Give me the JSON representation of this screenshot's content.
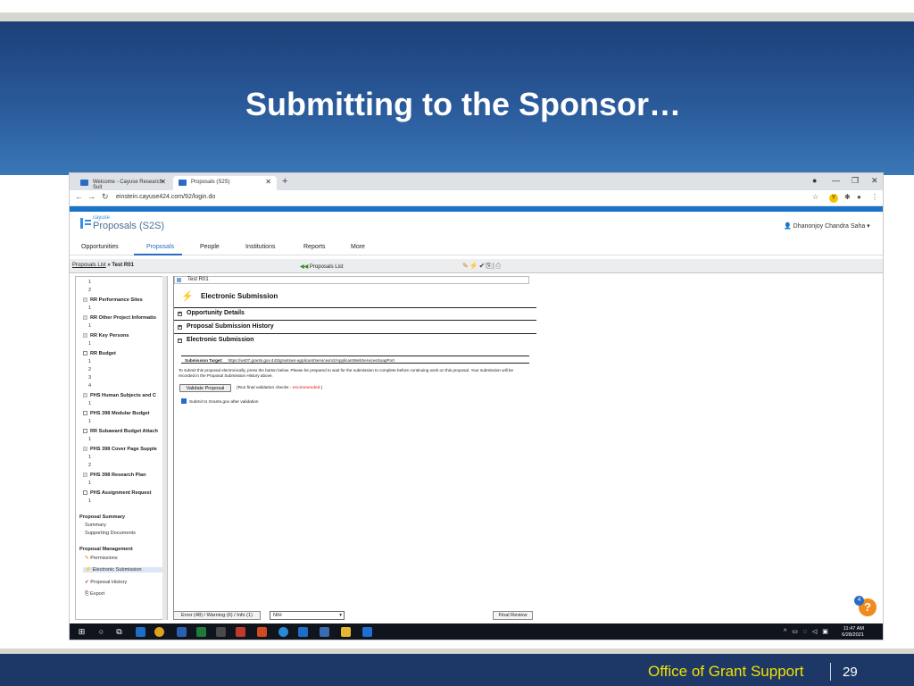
{
  "slide": {
    "title": "Submitting to the Sponsor…",
    "footer_office": "Office of Grant Support",
    "page_number": "29"
  },
  "browser": {
    "tabs": [
      {
        "label": "Welcome - Cayuse Research Suit"
      },
      {
        "label": "Proposals (S2S)"
      }
    ],
    "url": "einstein.cayuse424.com/92/login.do"
  },
  "app": {
    "brand_small": "cayuse",
    "brand_big": "Proposals (S2S)",
    "user": "Dhanonjoy Chandra Saha",
    "menu": [
      "Opportunities",
      "Proposals",
      "People",
      "Institutions",
      "Reports",
      "More"
    ],
    "breadcrumb_link": "Proposals List",
    "breadcrumb_current": "» Test R01",
    "proposals_list": "Proposals List"
  },
  "sidebar": {
    "items": [
      "1",
      "2",
      "RR Performance Sites",
      "1",
      "RR Other Project Informatio",
      "1",
      "RR Key Persons",
      "1",
      "RR Budget",
      "1",
      "2",
      "3",
      "4",
      "PHS Human Subjects and C",
      "1",
      "PHS 398 Modular Budget",
      "1",
      "RR Subaward Budget Attach",
      "1",
      "PHS 398 Cover Page Supple",
      "1",
      "2",
      "PHS 398 Research Plan",
      "1",
      "PHS Assignment Request",
      "1"
    ],
    "summary_header": "Proposal Summary",
    "summary_items": [
      "Summary",
      "Supporting Documents"
    ],
    "management_header": "Proposal Management",
    "management_items": [
      "Permissions",
      "Electronic Submission",
      "Proposal History",
      "Export"
    ]
  },
  "content": {
    "doc_label": "Test R01",
    "heading": "Electronic Submission",
    "sections": [
      "Opportunity Details",
      "Proposal Submission History",
      "Electronic Submission"
    ],
    "submission_target_label": "Submission Target:",
    "submission_target_url": "https://ws07.grants.gov:443/grantsws-applicant/services/v2/ApplicantWebServicesSoapPort",
    "instructions": "To submit this proposal electronically, press the button below. Please be prepared to wait for the submission to complete before continuing work on this proposal. Your submission will be recorded in the Proposal Submission History above.",
    "validate_button": "Validate Proposal",
    "validate_note_prefix": "(Run final validation checks - ",
    "validate_note_recommended": "recommended",
    "validate_note_suffix": ".)",
    "submit_check_label": "Submit to Grants.gov after validation"
  },
  "status": {
    "errors_button": "Error (48) / Warning (6) / Info (1)",
    "agency_select": "NIH",
    "final_review_button": "Final Review",
    "help_count": "4"
  },
  "taskbar": {
    "time": "11:47 AM",
    "date": "6/28/2021"
  },
  "colors": {
    "header_band": "#1d3f78",
    "footer_band": "#1d3766",
    "footer_text": "#f2e100",
    "accent": "#2a6cc4",
    "help_orange": "#f08a1e"
  }
}
